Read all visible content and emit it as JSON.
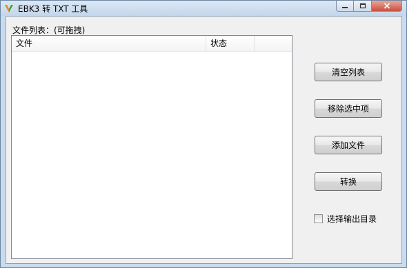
{
  "window": {
    "title": "EBK3 转 TXT 工具",
    "icon": "app-logo-icon",
    "caption_buttons": [
      "minimize-icon",
      "maximize-icon",
      "close-icon"
    ]
  },
  "file_list": {
    "label": "文件列表：(可拖拽)",
    "columns": [
      "文件",
      "状态"
    ],
    "rows": []
  },
  "actions": {
    "clear_list": "清空列表",
    "remove_selected": "移除选中项",
    "add_file": "添加文件",
    "convert": "转换"
  },
  "options": {
    "choose_output_dir_label": "选择输出目录",
    "choose_output_dir_checked": false
  },
  "colors": {
    "title_bar": "#c9dcef",
    "client_bg": "#f0f0f0",
    "close_button": "#c9503e",
    "logo_orange": "#f08a1c",
    "logo_green": "#3aa63a"
  }
}
